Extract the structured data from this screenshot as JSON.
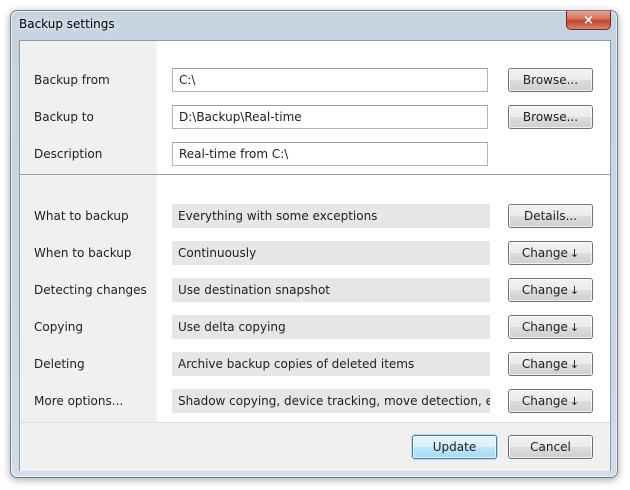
{
  "window": {
    "title": "Backup settings",
    "close_glyph": "×"
  },
  "paths": {
    "backup_from": {
      "label": "Backup from",
      "value": "C:\\",
      "button": "Browse..."
    },
    "backup_to": {
      "label": "Backup to",
      "value": "D:\\Backup\\Real-time",
      "button": "Browse..."
    },
    "description": {
      "label": "Description",
      "value": "Real-time from C:\\"
    }
  },
  "options": [
    {
      "label": "What to backup",
      "value": "Everything with some exceptions",
      "button": "Details..."
    },
    {
      "label": "When to backup",
      "value": "Continuously",
      "button": "Change",
      "arrow": "↓"
    },
    {
      "label": "Detecting changes",
      "value": "Use destination snapshot",
      "button": "Change",
      "arrow": "↓"
    },
    {
      "label": "Copying",
      "value": "Use delta copying",
      "button": "Change",
      "arrow": "↓"
    },
    {
      "label": "Deleting",
      "value": "Archive backup copies of deleted items",
      "button": "Change",
      "arrow": "↓"
    },
    {
      "label": "More options...",
      "value": "Shadow copying, device tracking, move detection, etc.",
      "button": "Change",
      "arrow": "↓"
    }
  ],
  "footer": {
    "update": "Update",
    "cancel": "Cancel"
  }
}
